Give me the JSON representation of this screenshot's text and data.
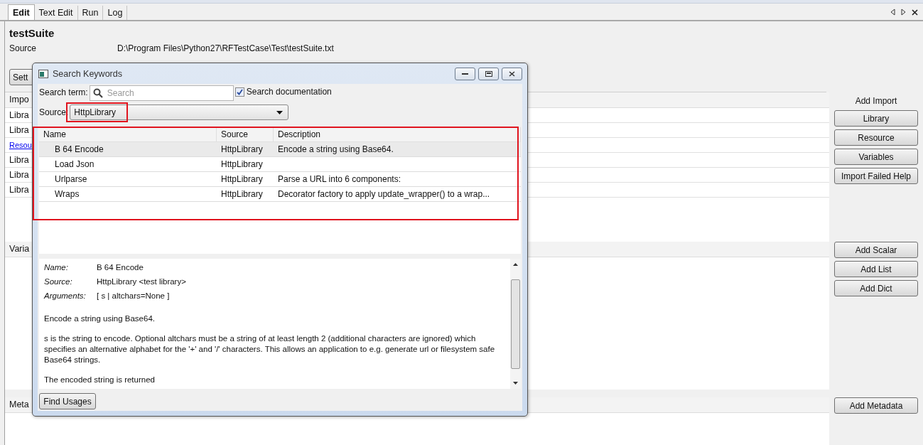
{
  "tabs": [
    {
      "label": "Edit",
      "selected": true
    },
    {
      "label": "Text Edit",
      "selected": false
    },
    {
      "label": "Run",
      "selected": false
    },
    {
      "label": "Log",
      "selected": false
    }
  ],
  "suite": {
    "title": "testSuite",
    "source_label": "Source",
    "source_path": "D:\\Program Files\\Python27\\RFTestCase\\Test\\testSuite.txt",
    "settings_button": "Sett"
  },
  "imports": {
    "header": "Impo",
    "rows": [
      {
        "text": "Libra",
        "kind": "library"
      },
      {
        "text": "Libra",
        "kind": "library"
      },
      {
        "text": "Resou",
        "kind": "resource"
      },
      {
        "text": "Libra",
        "kind": "library"
      },
      {
        "text": "Libra",
        "kind": "library"
      },
      {
        "text": "Libra",
        "kind": "library"
      }
    ],
    "side_title": "Add Import",
    "buttons": [
      "Library",
      "Resource",
      "Variables",
      "Import Failed Help"
    ]
  },
  "variables": {
    "header": "Varia",
    "buttons": [
      "Add Scalar",
      "Add List",
      "Add Dict"
    ]
  },
  "metadata": {
    "header": "Meta",
    "buttons": [
      "Add Metadata"
    ]
  },
  "dialog": {
    "title": "Search Keywords",
    "search_label": "Search term:",
    "search_placeholder": "Search",
    "search_documentation": {
      "label": "Search documentation",
      "checked": true
    },
    "source_label": "Source:",
    "source_value": "HttpLibrary",
    "source_highlighted": true,
    "columns": [
      "Name",
      "Source",
      "Description"
    ],
    "results_highlighted": true,
    "rows": [
      {
        "name": "B 64 Encode",
        "source": "HttpLibrary",
        "description": "Encode a string using Base64.",
        "selected": true
      },
      {
        "name": "Load Json",
        "source": "HttpLibrary",
        "selected": false
      },
      {
        "name": "Urlparse",
        "source": "HttpLibrary",
        "description": "Parse a URL into 6 components:",
        "selected": false
      },
      {
        "name": "Wraps",
        "source": "HttpLibrary",
        "description": "Decorator factory to apply update_wrapper() to a wrap...",
        "selected": false
      }
    ],
    "details": {
      "fields": [
        {
          "label": "Name:",
          "value": "B 64 Encode"
        },
        {
          "label": "Source:",
          "value": "HttpLibrary <test library>"
        },
        {
          "label": "Arguments:",
          "value": "[ s | altchars=None ]"
        }
      ],
      "paragraphs": [
        "Encode a string using Base64.",
        "s is the string to encode. Optional altchars must be a string of at least length 2 (additional characters are ignored) which specifies an alternative alphabet for the '+' and '/' characters. This allows an application to e.g. generate url or filesystem safe Base64 strings.",
        "The encoded string is returned"
      ]
    },
    "find_button": "Find Usages"
  }
}
